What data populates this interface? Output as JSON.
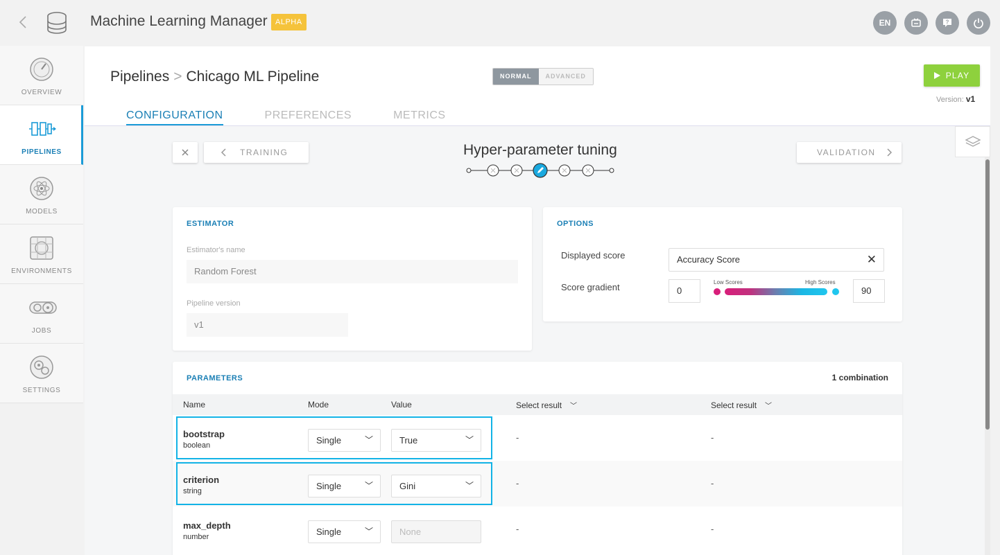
{
  "app": {
    "title": "Machine Learning Manager",
    "badge": "ALPHA"
  },
  "topbar": {
    "lang": "EN"
  },
  "sidebar": {
    "items": [
      {
        "label": "OVERVIEW",
        "icon": "gauge-icon"
      },
      {
        "label": "PIPELINES",
        "icon": "pipeline-icon",
        "active": true
      },
      {
        "label": "MODELS",
        "icon": "atom-icon"
      },
      {
        "label": "ENVIRONMENTS",
        "icon": "grid-icon"
      },
      {
        "label": "JOBS",
        "icon": "gears-icon"
      },
      {
        "label": "SETTINGS",
        "icon": "cog-icon"
      }
    ]
  },
  "header": {
    "breadcrumb_root": "Pipelines",
    "breadcrumb_current": "Chicago ML Pipeline",
    "mode_normal": "NORMAL",
    "mode_advanced": "ADVANCED",
    "play_label": "PLAY",
    "version_label": "Version:",
    "version_value": "v1",
    "tabs": [
      "CONFIGURATION",
      "PREFERENCES",
      "METRICS"
    ]
  },
  "wizard": {
    "prev_label": "TRAINING",
    "next_label": "VALIDATION",
    "step_title": "Hyper-parameter tuning"
  },
  "estimator": {
    "title": "ESTIMATOR",
    "name_label": "Estimator's name",
    "name_value": "Random Forest",
    "version_label": "Pipeline version",
    "version_value": "v1"
  },
  "options": {
    "title": "OPTIONS",
    "displayed_score_label": "Displayed score",
    "displayed_score_value": "Accuracy Score",
    "gradient_label": "Score gradient",
    "gradient_min": "0",
    "gradient_max": "90",
    "low_label": "Low Scores",
    "high_label": "High Scores",
    "colors": {
      "low": "#d81e7a",
      "high": "#20c6ee"
    }
  },
  "parameters": {
    "title": "PARAMETERS",
    "combinations": "1 combination",
    "columns": [
      "Name",
      "Mode",
      "Value",
      "Select result",
      "Select result"
    ],
    "rows": [
      {
        "name": "bootstrap",
        "type": "boolean",
        "mode": "Single",
        "value": "True",
        "r1": "-",
        "r2": "-"
      },
      {
        "name": "criterion",
        "type": "string",
        "mode": "Single",
        "value": "Gini",
        "r1": "-",
        "r2": "-"
      },
      {
        "name": "max_depth",
        "type": "number",
        "mode": "Single",
        "value_placeholder": "None",
        "r1": "-",
        "r2": "-"
      }
    ]
  }
}
